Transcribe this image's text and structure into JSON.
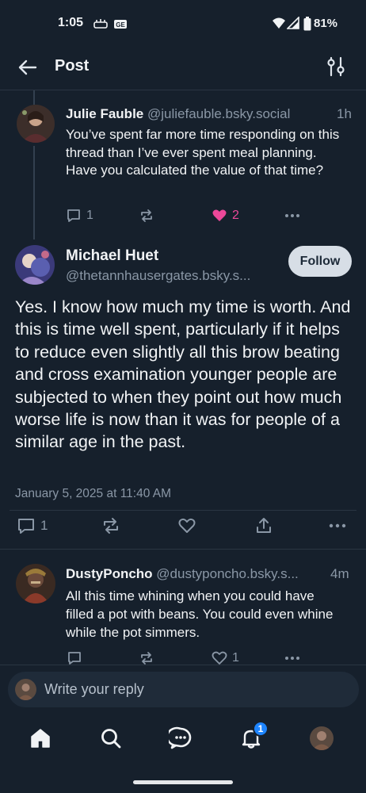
{
  "status_bar": {
    "time": "1:05",
    "battery": "81%"
  },
  "header": {
    "title": "Post"
  },
  "parent_post": {
    "author_name": "Julie Fauble",
    "author_handle": "@juliefauble.bsky.social",
    "age": "1h",
    "text": "You’ve spent far more time responding on this thread than I’ve ever spent meal planning. Have you calculated the value of that time?",
    "reply_count": "1",
    "like_count": "2"
  },
  "main_post": {
    "author_name": "Michael Huet",
    "author_handle": "@thetannhausergates.bsky.s...",
    "follow_label": "Follow",
    "text": "Yes.  I know how much my time is worth.  And this is time well spent, particularly if it helps to reduce even slightly all this brow beating and cross examination younger people are subjected to when they point out how much worse life is now than it was for people of a similar age in the past.",
    "timestamp": "January 5, 2025 at 11:40 AM",
    "reply_count": "1"
  },
  "reply_post": {
    "author_name": "DustyPoncho",
    "author_handle": "@dustyponcho.bsky.s...",
    "age": "4m",
    "text": "All this time whining when you could have filled a pot with beans. You could even whine while the pot simmers.",
    "like_count": "1"
  },
  "composer": {
    "placeholder": "Write your reply"
  },
  "nav": {
    "notification_badge": "1"
  },
  "colors": {
    "background": "#16202c",
    "like_active": "#ec4899",
    "accent": "#1e85ff"
  }
}
